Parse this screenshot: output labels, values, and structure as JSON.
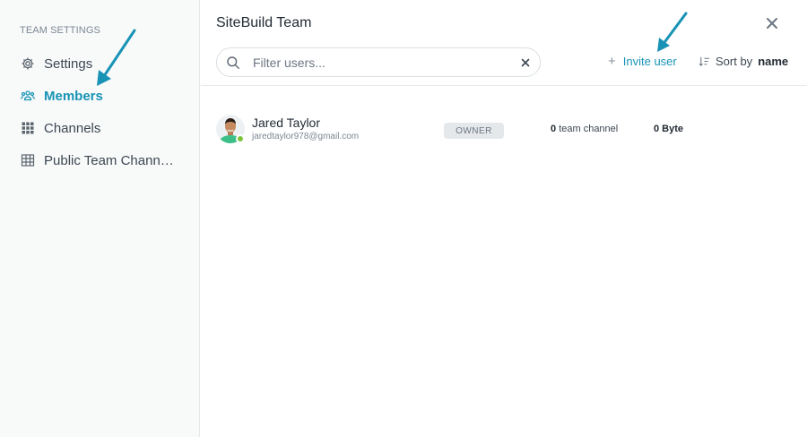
{
  "sidebar": {
    "heading": "TEAM SETTINGS",
    "items": [
      {
        "label": "Settings",
        "icon": "gear-icon",
        "active": false
      },
      {
        "label": "Members",
        "icon": "people-icon",
        "active": true
      },
      {
        "label": "Channels",
        "icon": "grid-icon",
        "active": false
      },
      {
        "label": "Public Team Chann…",
        "icon": "table-icon",
        "active": false
      }
    ]
  },
  "header": {
    "title": "SiteBuild Team",
    "close_icon": "close-icon"
  },
  "toolbar": {
    "search_placeholder": "Filter users...",
    "search_value": "",
    "invite_plus": "+",
    "invite_label": "Invite user",
    "sort_prefix": "Sort by",
    "sort_value": "name"
  },
  "members": [
    {
      "name": "Jared Taylor",
      "email": "jaredtaylor978@gmail.com",
      "role": "OWNER",
      "channels_count": "0",
      "channels_label": "team channel",
      "storage": "0 Byte",
      "online": true
    }
  ],
  "colors": {
    "accent": "#1893b5",
    "online": "#7dc43c",
    "sidebar_bg": "#f8fafa"
  }
}
